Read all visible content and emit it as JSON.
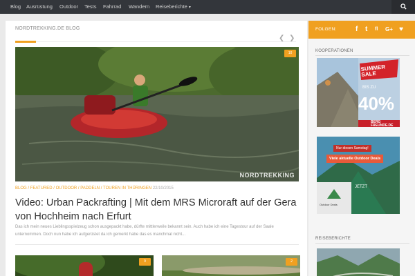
{
  "nav": {
    "items": [
      "Blog",
      "Ausrüstung",
      "Outdoor",
      "Tests",
      "Fahrrad",
      "Wandern",
      "Reiseberichte"
    ],
    "reiseberichte_caret": "▾"
  },
  "content": {
    "heading_site": "NORDTREKKING.DE",
    "heading_section": "BLOG",
    "slider_prev": "❮",
    "slider_next": "❯",
    "featured": {
      "comments": "10",
      "watermark": "NORDTREKKING",
      "categories": "BLOG / FEATURED / OUTDOOR / PADDELN / TOUREN IN THÜRINGEN",
      "date": "22/10/2015",
      "title": "Video: Urban Packrafting | Mit dem MRS Microraft auf der Gera von Hochheim nach Erfurt",
      "excerpt": "Das ich mein neues Lieblingsspielzeug schon ausgepackt habe, dürfte mittlerweile bekannt sein. Auch habe ich eine Tagestour auf der Saale unternommen. Doch nun habe ich aufgerüstet da ich gemerkt habe das es manchmal nicht..."
    },
    "thumb_1_comments": "9",
    "thumb_2_comments": "2"
  },
  "sidebar": {
    "follow_label": "FOLGEN:",
    "social": [
      "f",
      "t",
      "fl",
      "G+",
      "♥"
    ],
    "kooperationen": "KOOPERATIONEN",
    "ad_sale": {
      "title": "SUMMER SALE",
      "percent_prefix": "BIS ZU",
      "percent": "40%",
      "brand": "BERG FREUNDE.DE"
    },
    "ad_outdoor": {
      "banner": "Nur diesen Samstag!",
      "cta": "Viele aktuelle Outdoor Deals",
      "brand": "Outdoor Deals",
      "button": "JETZT"
    },
    "reiseberichte": "REISEBERICHTE"
  }
}
